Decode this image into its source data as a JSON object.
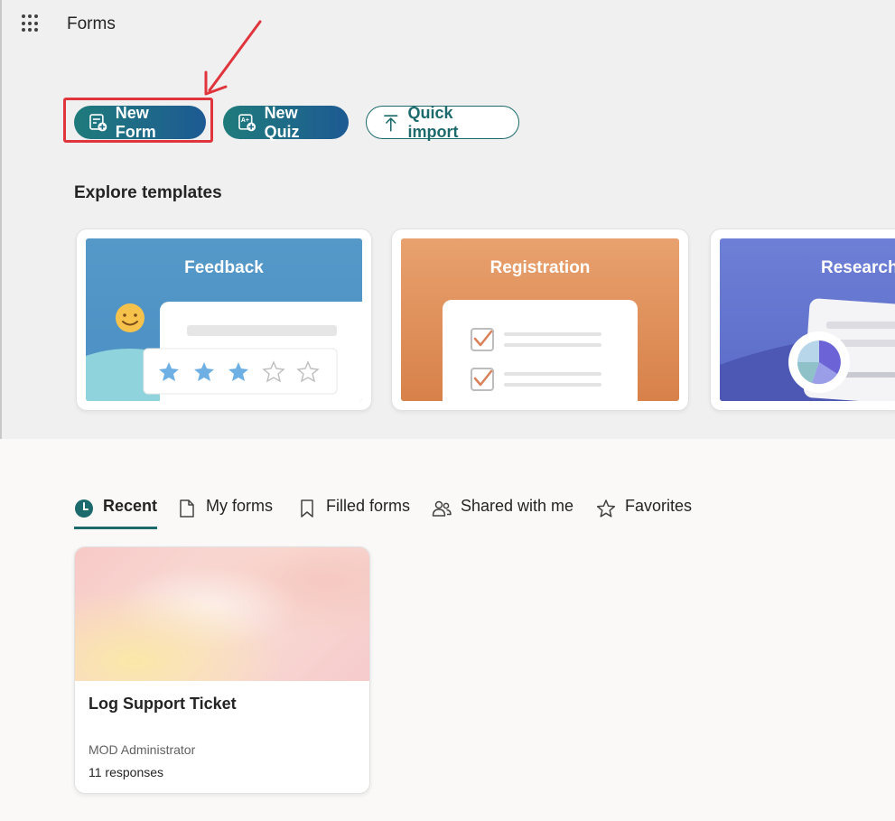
{
  "app": {
    "title": "Forms"
  },
  "actions": {
    "new_form": "New Form",
    "new_quiz": "New Quiz",
    "quick_import": "Quick import"
  },
  "templates": {
    "section_title": "Explore templates",
    "items": [
      {
        "label": "Feedback"
      },
      {
        "label": "Registration"
      },
      {
        "label": "Research"
      }
    ]
  },
  "tabs": [
    {
      "label": "Recent",
      "icon": "clock-icon",
      "active": true
    },
    {
      "label": "My forms",
      "icon": "document-icon"
    },
    {
      "label": "Filled forms",
      "icon": "bookmark-icon"
    },
    {
      "label": "Shared with me",
      "icon": "people-icon"
    },
    {
      "label": "Favorites",
      "icon": "star-icon"
    }
  ],
  "recent_forms": [
    {
      "title": "Log Support Ticket",
      "owner": "MOD Administrator",
      "responses": "11 responses"
    }
  ],
  "colors": {
    "accent": "#1c6a6b",
    "annotation": "#e0353d"
  }
}
